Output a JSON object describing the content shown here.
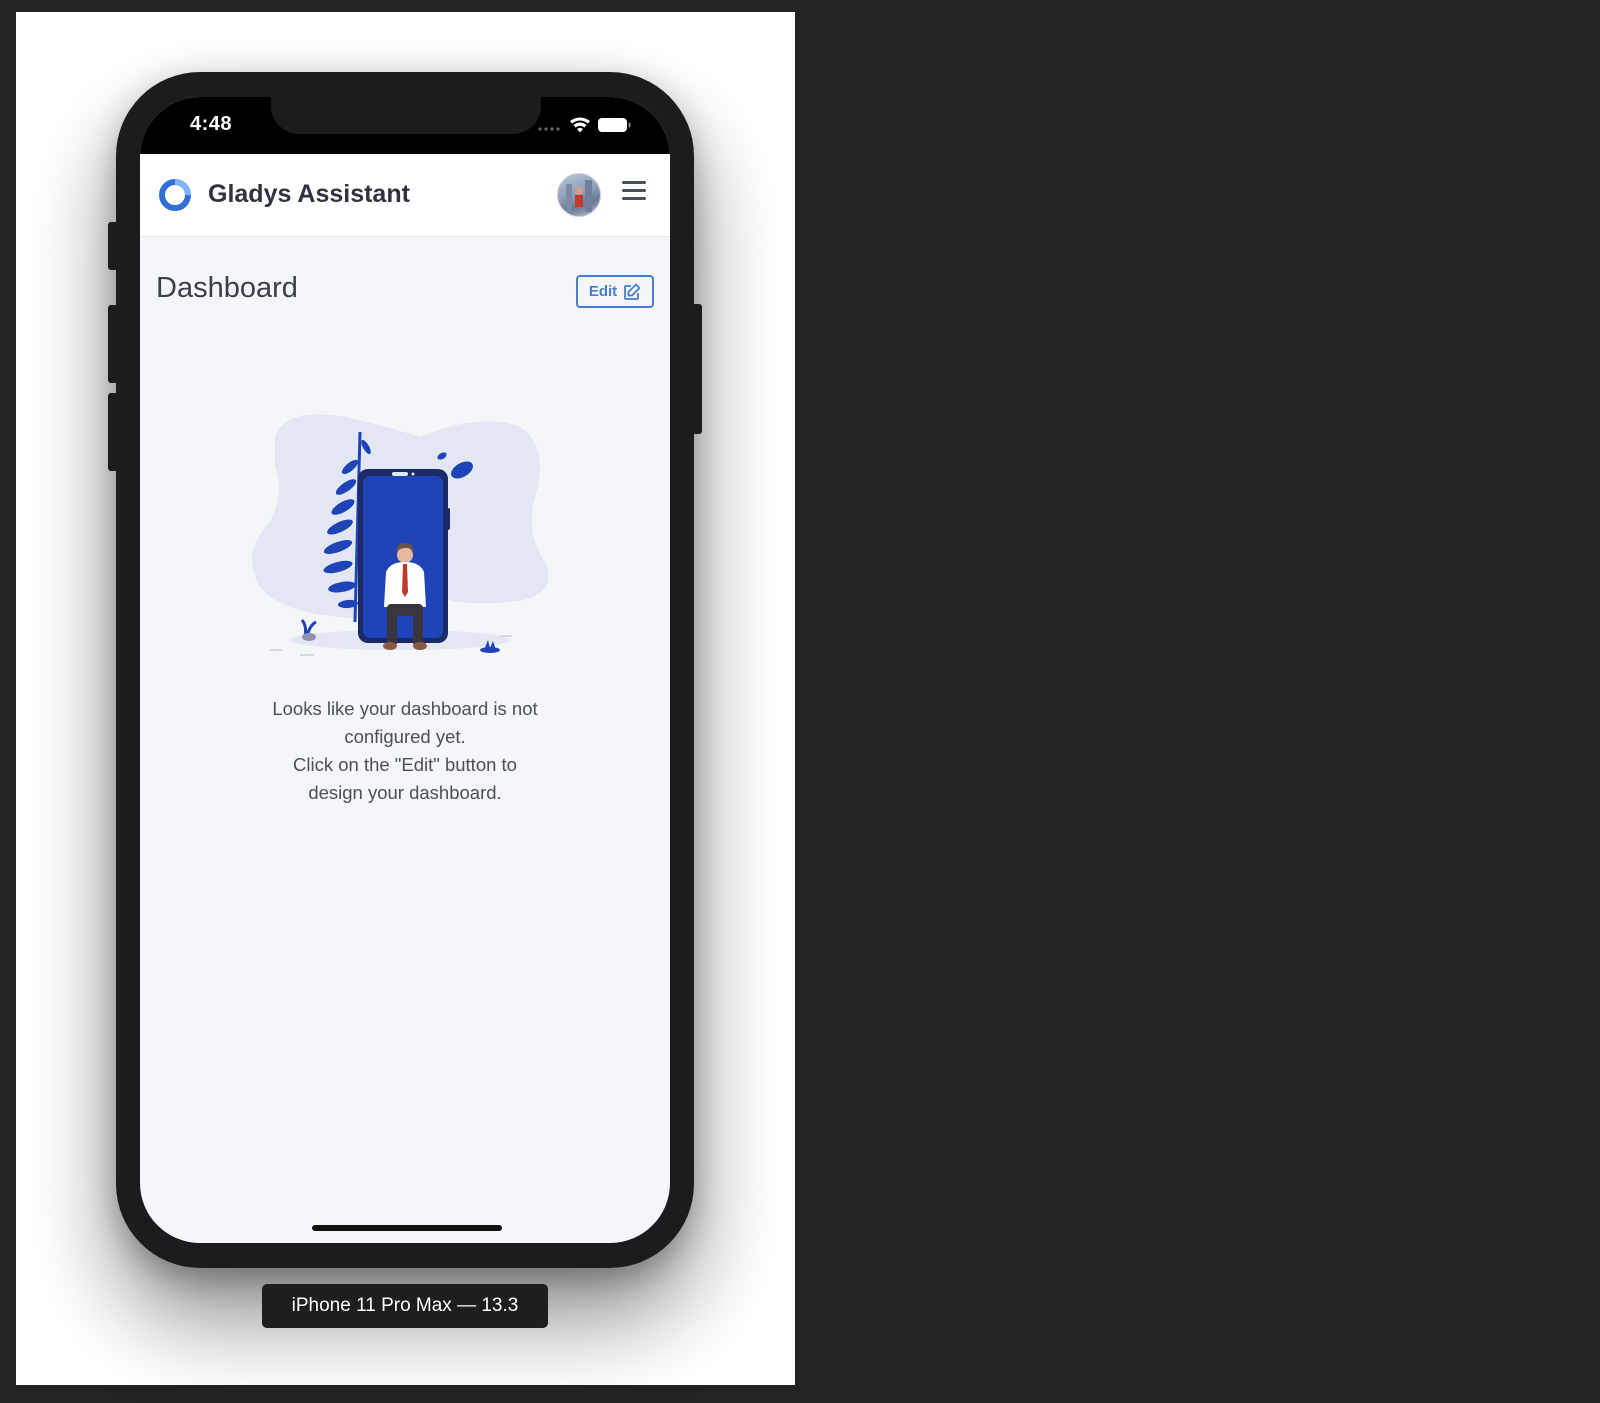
{
  "statusbar": {
    "time": "4:48"
  },
  "navbar": {
    "brand": "Gladys Assistant"
  },
  "page": {
    "title": "Dashboard",
    "edit_label": "Edit"
  },
  "empty_state": {
    "line1": "Looks like your dashboard is not",
    "line2": "configured yet.",
    "line3": "Click on the \"Edit\" button to",
    "line4": "design your dashboard."
  },
  "simulator": {
    "device_label": "iPhone 11 Pro Max — 13.3"
  },
  "colors": {
    "accent": "#467fcf",
    "illustration_blue": "#1f44b8",
    "blob": "#e3e7f4",
    "screen_bg": "#f5f6fa"
  },
  "icons": [
    "wifi-icon",
    "battery-icon",
    "signal-icon",
    "gladys-logo-icon",
    "hamburger-menu-icon",
    "edit-icon"
  ]
}
